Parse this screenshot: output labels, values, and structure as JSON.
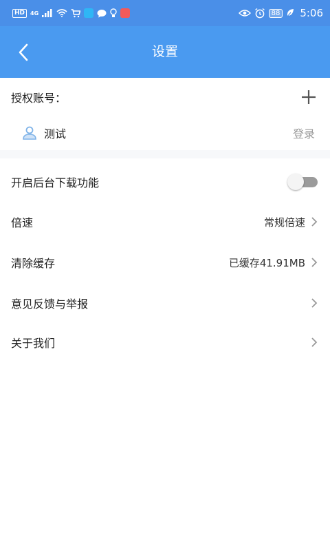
{
  "status_bar": {
    "left_badges": [
      "HD",
      "4G"
    ],
    "battery": "88",
    "time": "5:06"
  },
  "header": {
    "title": "设置",
    "back_icon": "chevron-left-icon"
  },
  "account": {
    "label": "授权账号：",
    "add_icon": "plus-icon",
    "user_name": "测试",
    "login_label": "登录",
    "user_icon": "user-icon"
  },
  "settings": {
    "background_download_label": "开启后台下载功能",
    "background_download_enabled": false,
    "speed_label": "倍速",
    "speed_value": "常规倍速",
    "clear_cache_label": "清除缓存",
    "clear_cache_value": "已缓存41.91MB",
    "feedback_label": "意见反馈与举报",
    "about_label": "关于我们"
  },
  "colors": {
    "status_bar": "#4a8fe8",
    "app_bar": "#4a9af0",
    "user_icon": "#7fb3e8",
    "muted_text": "#9a9a9a"
  }
}
